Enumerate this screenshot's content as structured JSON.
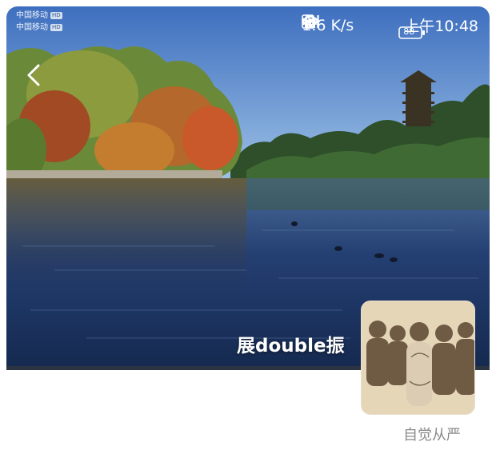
{
  "status_bar": {
    "carrier_1": "中国移动",
    "carrier_2": "中国移动",
    "carrier_badge": "HD",
    "net_speed": "1.6 K/s",
    "battery": "88",
    "time": "上午10:48",
    "icons": [
      "bluetooth-icon",
      "nfc-icon",
      "vibrate-icon",
      "eye-icon",
      "wifi-icon",
      "signal-icon",
      "signal-icon",
      "battery-icon"
    ]
  },
  "header": {
    "back_icon": "chevron-left-icon"
  },
  "profile": {
    "name": "展double振",
    "avatar_caption": "自觉从严"
  },
  "colors": {
    "sky": "#5b86c8",
    "water": "#1f3c6e",
    "caption": "#8a8a8a"
  }
}
